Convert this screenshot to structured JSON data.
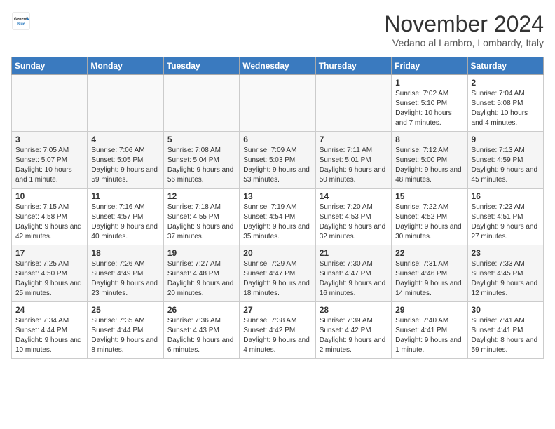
{
  "header": {
    "logo_general": "General",
    "logo_blue": "Blue",
    "month": "November 2024",
    "location": "Vedano al Lambro, Lombardy, Italy"
  },
  "days_of_week": [
    "Sunday",
    "Monday",
    "Tuesday",
    "Wednesday",
    "Thursday",
    "Friday",
    "Saturday"
  ],
  "weeks": [
    [
      {
        "day": "",
        "info": ""
      },
      {
        "day": "",
        "info": ""
      },
      {
        "day": "",
        "info": ""
      },
      {
        "day": "",
        "info": ""
      },
      {
        "day": "",
        "info": ""
      },
      {
        "day": "1",
        "info": "Sunrise: 7:02 AM\nSunset: 5:10 PM\nDaylight: 10 hours and 7 minutes."
      },
      {
        "day": "2",
        "info": "Sunrise: 7:04 AM\nSunset: 5:08 PM\nDaylight: 10 hours and 4 minutes."
      }
    ],
    [
      {
        "day": "3",
        "info": "Sunrise: 7:05 AM\nSunset: 5:07 PM\nDaylight: 10 hours and 1 minute."
      },
      {
        "day": "4",
        "info": "Sunrise: 7:06 AM\nSunset: 5:05 PM\nDaylight: 9 hours and 59 minutes."
      },
      {
        "day": "5",
        "info": "Sunrise: 7:08 AM\nSunset: 5:04 PM\nDaylight: 9 hours and 56 minutes."
      },
      {
        "day": "6",
        "info": "Sunrise: 7:09 AM\nSunset: 5:03 PM\nDaylight: 9 hours and 53 minutes."
      },
      {
        "day": "7",
        "info": "Sunrise: 7:11 AM\nSunset: 5:01 PM\nDaylight: 9 hours and 50 minutes."
      },
      {
        "day": "8",
        "info": "Sunrise: 7:12 AM\nSunset: 5:00 PM\nDaylight: 9 hours and 48 minutes."
      },
      {
        "day": "9",
        "info": "Sunrise: 7:13 AM\nSunset: 4:59 PM\nDaylight: 9 hours and 45 minutes."
      }
    ],
    [
      {
        "day": "10",
        "info": "Sunrise: 7:15 AM\nSunset: 4:58 PM\nDaylight: 9 hours and 42 minutes."
      },
      {
        "day": "11",
        "info": "Sunrise: 7:16 AM\nSunset: 4:57 PM\nDaylight: 9 hours and 40 minutes."
      },
      {
        "day": "12",
        "info": "Sunrise: 7:18 AM\nSunset: 4:55 PM\nDaylight: 9 hours and 37 minutes."
      },
      {
        "day": "13",
        "info": "Sunrise: 7:19 AM\nSunset: 4:54 PM\nDaylight: 9 hours and 35 minutes."
      },
      {
        "day": "14",
        "info": "Sunrise: 7:20 AM\nSunset: 4:53 PM\nDaylight: 9 hours and 32 minutes."
      },
      {
        "day": "15",
        "info": "Sunrise: 7:22 AM\nSunset: 4:52 PM\nDaylight: 9 hours and 30 minutes."
      },
      {
        "day": "16",
        "info": "Sunrise: 7:23 AM\nSunset: 4:51 PM\nDaylight: 9 hours and 27 minutes."
      }
    ],
    [
      {
        "day": "17",
        "info": "Sunrise: 7:25 AM\nSunset: 4:50 PM\nDaylight: 9 hours and 25 minutes."
      },
      {
        "day": "18",
        "info": "Sunrise: 7:26 AM\nSunset: 4:49 PM\nDaylight: 9 hours and 23 minutes."
      },
      {
        "day": "19",
        "info": "Sunrise: 7:27 AM\nSunset: 4:48 PM\nDaylight: 9 hours and 20 minutes."
      },
      {
        "day": "20",
        "info": "Sunrise: 7:29 AM\nSunset: 4:47 PM\nDaylight: 9 hours and 18 minutes."
      },
      {
        "day": "21",
        "info": "Sunrise: 7:30 AM\nSunset: 4:47 PM\nDaylight: 9 hours and 16 minutes."
      },
      {
        "day": "22",
        "info": "Sunrise: 7:31 AM\nSunset: 4:46 PM\nDaylight: 9 hours and 14 minutes."
      },
      {
        "day": "23",
        "info": "Sunrise: 7:33 AM\nSunset: 4:45 PM\nDaylight: 9 hours and 12 minutes."
      }
    ],
    [
      {
        "day": "24",
        "info": "Sunrise: 7:34 AM\nSunset: 4:44 PM\nDaylight: 9 hours and 10 minutes."
      },
      {
        "day": "25",
        "info": "Sunrise: 7:35 AM\nSunset: 4:44 PM\nDaylight: 9 hours and 8 minutes."
      },
      {
        "day": "26",
        "info": "Sunrise: 7:36 AM\nSunset: 4:43 PM\nDaylight: 9 hours and 6 minutes."
      },
      {
        "day": "27",
        "info": "Sunrise: 7:38 AM\nSunset: 4:42 PM\nDaylight: 9 hours and 4 minutes."
      },
      {
        "day": "28",
        "info": "Sunrise: 7:39 AM\nSunset: 4:42 PM\nDaylight: 9 hours and 2 minutes."
      },
      {
        "day": "29",
        "info": "Sunrise: 7:40 AM\nSunset: 4:41 PM\nDaylight: 9 hours and 1 minute."
      },
      {
        "day": "30",
        "info": "Sunrise: 7:41 AM\nSunset: 4:41 PM\nDaylight: 8 hours and 59 minutes."
      }
    ]
  ]
}
